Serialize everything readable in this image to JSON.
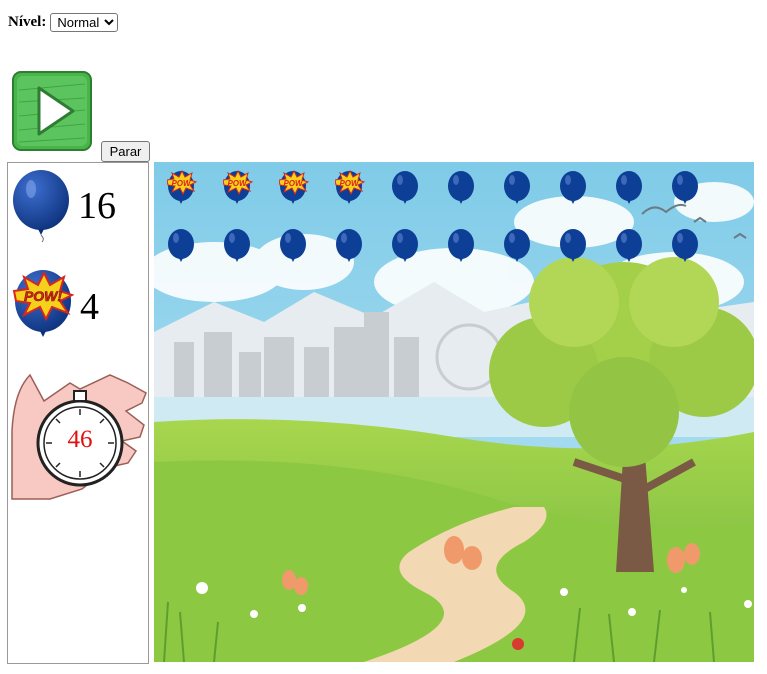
{
  "level": {
    "label": "Nível:",
    "selected": "Normal"
  },
  "controls": {
    "play_icon": "play-icon",
    "stop_label": "Parar"
  },
  "stats": {
    "intact_count": "16",
    "popped_count": "4",
    "timer": "46"
  },
  "colors": {
    "balloon": "#0d3f96",
    "timer_digits": "#e01010",
    "play_green": "#3fb043",
    "pow_yellow": "#f6d11b",
    "pow_red": "#d8261f"
  },
  "balloons": [
    {
      "popped": true,
      "pow": "POW"
    },
    {
      "popped": true,
      "pow": "POW"
    },
    {
      "popped": true,
      "pow": "POW"
    },
    {
      "popped": true,
      "pow": "POW"
    },
    {
      "popped": false
    },
    {
      "popped": false
    },
    {
      "popped": false
    },
    {
      "popped": false
    },
    {
      "popped": false
    },
    {
      "popped": false
    },
    {
      "popped": false
    },
    {
      "popped": false
    },
    {
      "popped": false
    },
    {
      "popped": false
    },
    {
      "popped": false
    },
    {
      "popped": false
    },
    {
      "popped": false
    },
    {
      "popped": false
    },
    {
      "popped": false
    },
    {
      "popped": false
    }
  ],
  "side_icons": {
    "balloon": "blue-balloon-icon",
    "pow": "pow-balloon-icon",
    "timer": "stopwatch-icon"
  },
  "scene": {
    "pow_text": "POW!"
  }
}
